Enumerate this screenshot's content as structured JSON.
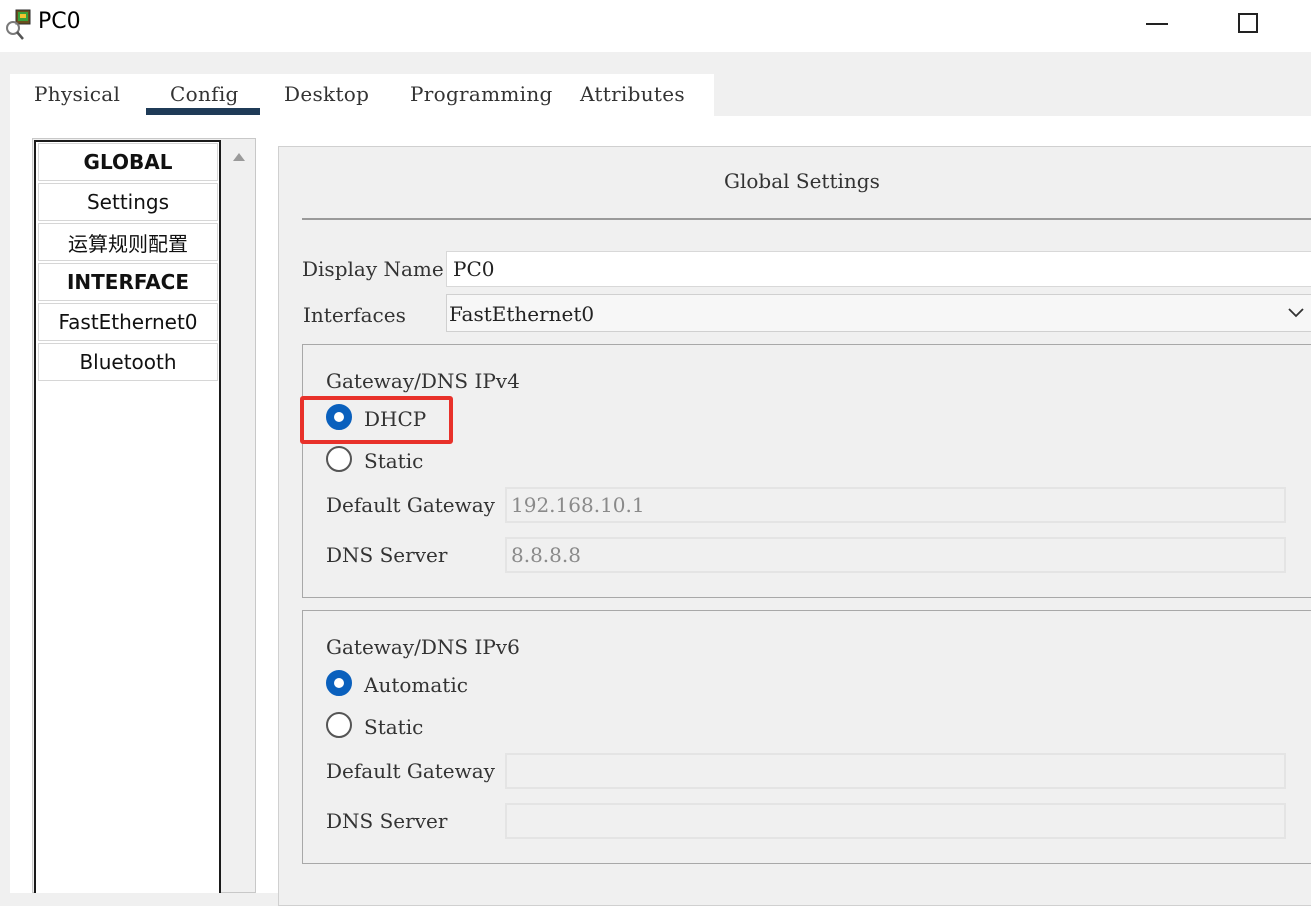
{
  "window": {
    "title": "PC0",
    "app_icon": "packet-tracer-pc-icon",
    "minimize_icon": "minimize-icon",
    "maximize_icon": "maximize-icon"
  },
  "tabs": [
    {
      "label": "Physical",
      "active": false
    },
    {
      "label": "Config",
      "active": true
    },
    {
      "label": "Desktop",
      "active": false
    },
    {
      "label": "Programming",
      "active": false
    },
    {
      "label": "Attributes",
      "active": false
    }
  ],
  "sidebar": {
    "items": [
      {
        "label": "GLOBAL",
        "header": true
      },
      {
        "label": "Settings",
        "header": false
      },
      {
        "label": "运算规则配置",
        "header": false
      },
      {
        "label": "INTERFACE",
        "header": true
      },
      {
        "label": "FastEthernet0",
        "header": false
      },
      {
        "label": "Bluetooth",
        "header": false
      }
    ]
  },
  "global_settings": {
    "title": "Global Settings",
    "display_name_label": "Display Name",
    "display_name_value": "PC0",
    "interfaces_label": "Interfaces",
    "interfaces_value": "FastEthernet0",
    "ipv4": {
      "title": "Gateway/DNS IPv4",
      "option_dhcp": "DHCP",
      "option_static": "Static",
      "selected": "DHCP",
      "default_gateway_label": "Default Gateway",
      "default_gateway_value": "192.168.10.1",
      "dns_server_label": "DNS Server",
      "dns_server_value": "8.8.8.8"
    },
    "ipv6": {
      "title": "Gateway/DNS IPv6",
      "option_automatic": "Automatic",
      "option_static": "Static",
      "selected": "Automatic",
      "default_gateway_label": "Default Gateway",
      "default_gateway_value": "",
      "dns_server_label": "DNS Server",
      "dns_server_value": ""
    }
  },
  "colors": {
    "accent": "#0a60bd",
    "tab_underline": "#1f3b57",
    "highlight": "#e8312a"
  }
}
